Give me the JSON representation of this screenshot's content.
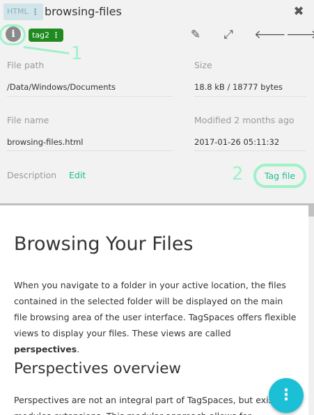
{
  "header": {
    "extension": "HTML",
    "extension_menu": "⋮",
    "title": "browsing-files",
    "close_icon": "✖"
  },
  "toolbar": {
    "info_label": "i",
    "tag": {
      "label": "tag2",
      "menu": "⋮",
      "color": "#1f8a1f"
    },
    "edit_icon": "✎",
    "fullscreen_icon": "⤢",
    "prev_icon": "🡐",
    "next_icon": "🡒"
  },
  "annotations": {
    "callout_1": "1",
    "callout_2": "2",
    "color": "#9ef2c8"
  },
  "properties": {
    "file_path_label": "File path",
    "file_path_value": "/Data/Windows/Documents",
    "size_label": "Size",
    "size_value": "18.8 kB / 18777 bytes",
    "file_name_label": "File name",
    "file_name_value": "browsing-files.html",
    "modified_label": "Modified 2 months ago",
    "modified_value": "2017-01-26 05:11:32",
    "description_label": "Description",
    "edit_label": "Edit",
    "tag_file_label": "Tag file",
    "accent": "#1dbf8b"
  },
  "document": {
    "heading": "Browsing Your Files",
    "paragraph1_start": "When you navigate to a folder in your active location, the files contained in the selected folder will be displayed on the main file browsing area of the user interface. TagSpaces offers flexible views to display your files. These views are called ",
    "paragraph1_bold": "perspectives",
    "paragraph1_end": ".",
    "subheading": "Perspectives overview",
    "paragraph2": "Perspectives are not an integral part of TagSpaces, but exist as modules extensions. This modular approach allows for"
  },
  "fab": {
    "icon": "⋮",
    "color": "#1cc0d6"
  }
}
